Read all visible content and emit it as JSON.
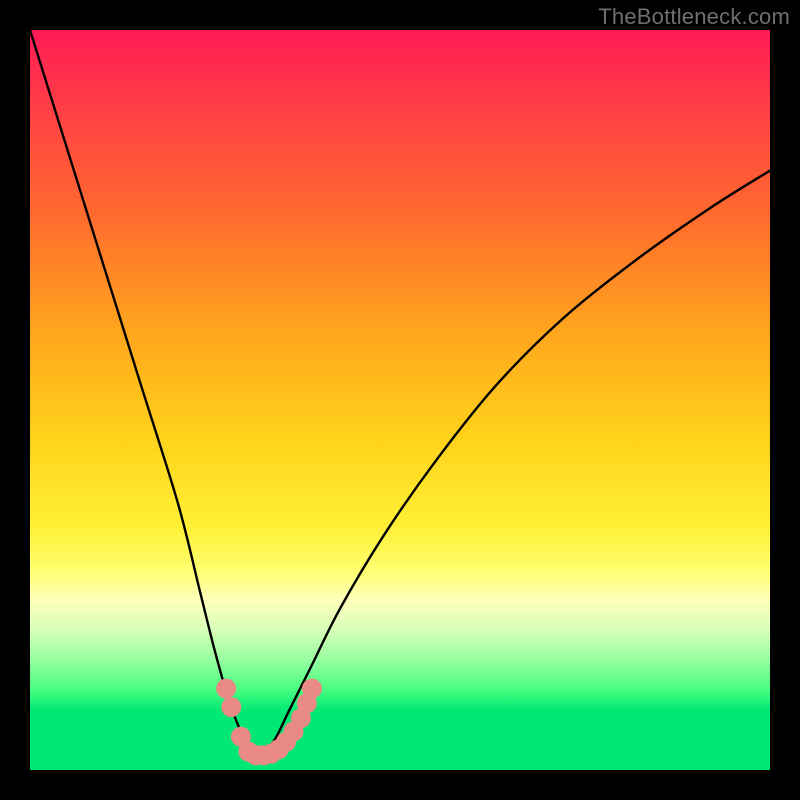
{
  "watermark": "TheBottleneck.com",
  "chart_data": {
    "type": "line",
    "title": "",
    "xlabel": "",
    "ylabel": "",
    "xlim": [
      0,
      100
    ],
    "ylim": [
      0,
      100
    ],
    "series": [
      {
        "name": "bottleneck-curve",
        "x": [
          0,
          5,
          10,
          15,
          20,
          23,
          25,
          27,
          29,
          30,
          31,
          33,
          35,
          38,
          42,
          48,
          55,
          63,
          72,
          82,
          92,
          100
        ],
        "values": [
          100,
          84,
          68,
          52,
          36,
          24,
          16,
          9,
          4,
          2,
          2,
          4,
          8,
          14,
          22,
          32,
          42,
          52,
          61,
          69,
          76,
          81
        ]
      }
    ],
    "green_band_y": [
      0,
      8
    ],
    "markers": {
      "name": "highlight-dots",
      "color": "#e98a85",
      "points": [
        {
          "x": 26.5,
          "y": 11
        },
        {
          "x": 27.2,
          "y": 8.5
        },
        {
          "x": 28.5,
          "y": 4.5
        },
        {
          "x": 29.5,
          "y": 2.5
        },
        {
          "x": 30.5,
          "y": 2.0
        },
        {
          "x": 31.6,
          "y": 2.0
        },
        {
          "x": 32.6,
          "y": 2.2
        },
        {
          "x": 33.6,
          "y": 2.8
        },
        {
          "x": 34.6,
          "y": 3.8
        },
        {
          "x": 35.6,
          "y": 5.2
        },
        {
          "x": 36.6,
          "y": 7.0
        },
        {
          "x": 37.4,
          "y": 9.0
        },
        {
          "x": 38.1,
          "y": 11.0
        }
      ]
    }
  }
}
